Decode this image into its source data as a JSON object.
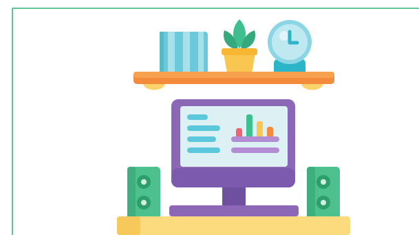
{
  "illustration": {
    "subject": "home-office-desk-setup",
    "colors": {
      "frame_border": "#5FC39A",
      "shelf": "#F48A3C",
      "shelf_top": "#F7A04E",
      "bracket": "#FBD36A",
      "book_teal": "#6BC9DA",
      "book_light": "#A6E1EA",
      "plant_green": "#3FBF8F",
      "pot_yellow": "#F9C74F",
      "clock_face": "#BFE9F1",
      "clock_ring": "#8AD6E4",
      "clock_base": "#2CB5C9",
      "monitor_frame": "#8B67B6",
      "monitor_frame_dark": "#6F4FA0",
      "screen_bg": "#DDF1F4",
      "screen_lines": "#5BC7DA",
      "chart_bar_red": "#F0626F",
      "chart_bar_green": "#3FBF8F",
      "chart_bar_yellow": "#F9C74F",
      "chart_bar_orange": "#F48A3C",
      "screen_purple_lines": "#B38DD1",
      "speaker_green": "#4CC18E",
      "speaker_dark": "#2E9E6C",
      "desk_yellow": "#FBDB7E",
      "desk_dark": "#F7C95A"
    },
    "icons": [
      "books-icon",
      "potted-plant-icon",
      "desk-clock-icon",
      "computer-monitor-icon",
      "bar-chart-icon",
      "speaker-icon",
      "desk-icon",
      "wall-shelf-icon"
    ]
  }
}
